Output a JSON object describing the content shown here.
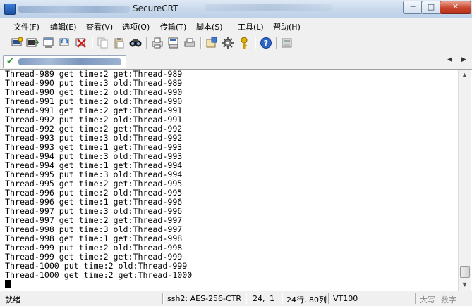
{
  "window": {
    "title": "SecureCRT",
    "controls": {
      "minimize": "─",
      "maximize": "□",
      "close": "✕"
    }
  },
  "menu": [
    "文件(F)",
    "编辑(E)",
    "查看(V)",
    "选项(O)",
    "传输(T)",
    "脚本(S)",
    "工具(L)",
    "帮助(H)"
  ],
  "toolbar": {
    "icons": [
      "connect-icon",
      "quick-connect-icon",
      "connect-in-tab-icon",
      "reconnect-icon",
      "disconnect-icon",
      "copy-icon",
      "paste-icon",
      "find-icon",
      "print-icon",
      "print-selection-icon",
      "print-setup-icon",
      "session-options-icon",
      "global-options-icon",
      "keymap-icon",
      "help-icon",
      "sftp-icon"
    ]
  },
  "session_tab": {
    "status_icon": "check-icon"
  },
  "terminal": {
    "lines": [
      "Thread-989 get time:2 get:Thread-989",
      "Thread-990 put time:3 old:Thread-989",
      "Thread-990 get time:2 old:Thread-990",
      "Thread-991 put time:2 old:Thread-990",
      "Thread-991 get time:2 get:Thread-991",
      "Thread-992 put time:2 old:Thread-991",
      "Thread-992 get time:2 get:Thread-992",
      "Thread-993 put time:3 old:Thread-992",
      "Thread-993 get time:1 get:Thread-993",
      "Thread-994 put time:3 old:Thread-993",
      "Thread-994 get time:1 get:Thread-994",
      "Thread-995 put time:3 old:Thread-994",
      "Thread-995 get time:2 get:Thread-995",
      "Thread-996 put time:2 old:Thread-995",
      "Thread-996 get time:1 get:Thread-996",
      "Thread-997 put time:3 old:Thread-996",
      "Thread-997 get time:2 get:Thread-997",
      "Thread-998 put time:3 old:Thread-997",
      "Thread-998 get time:1 get:Thread-998",
      "Thread-999 put time:2 old:Thread-998",
      "Thread-999 get time:2 get:Thread-999",
      "Thread-1000 put time:2 old:Thread-999",
      "Thread-1000 get time:2 get:Thread-1000"
    ]
  },
  "statusbar": {
    "ready": "就绪",
    "cipher": "ssh2: AES-256-CTR",
    "row": "24,",
    "col": "1",
    "size": "24行, 80列",
    "term": "VT100",
    "caps": "大写",
    "num": "数字"
  }
}
